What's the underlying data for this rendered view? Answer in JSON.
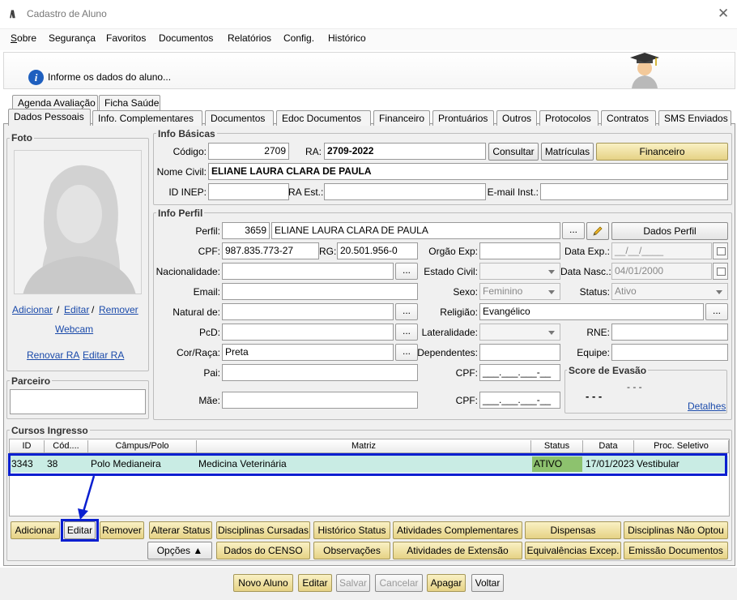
{
  "window": {
    "title": "Cadastro de Aluno",
    "logo": "/\\\\",
    "close_glyph": "✕"
  },
  "menu": [
    "Sobre",
    "Segurança",
    "Favoritos",
    "Documentos",
    "Relatórios",
    "Config.",
    "Histórico"
  ],
  "header": {
    "info_text": "Informe os dados do aluno...",
    "info_icon": "i"
  },
  "tabs_top": [
    "Agenda Avaliação",
    "Ficha Saúde"
  ],
  "tabs": [
    "Dados Pessoais",
    "Info. Complementares",
    "Documentos",
    "Edoc Documentos",
    "Financeiro",
    "Prontuários",
    "Outros",
    "Protocolos",
    "Contratos",
    "SMS Enviados"
  ],
  "foto": {
    "title": "Foto",
    "adicionar": "Adicionar",
    "sep1": "/",
    "editar": "Editar",
    "sep2": "/",
    "remover": "Remover",
    "webcam": "Webcam",
    "renovar_ra": "Renovar RA",
    "editar_ra": "Editar RA"
  },
  "parceiro": {
    "title": "Parceiro"
  },
  "info_basicas": {
    "title": "Info Básicas",
    "codigo_label": "Código:",
    "codigo": "2709",
    "ra_label": "RA:",
    "ra": "2709-2022",
    "consultar": "Consultar",
    "matriculas": "Matrículas",
    "financeiro": "Financeiro",
    "nome_civil_label": "Nome Civil:",
    "nome_civil": "ELIANE LAURA CLARA DE PAULA",
    "id_inep_label": "ID INEP:",
    "ra_est_label": "RA Est.:",
    "email_inst_label": "E-mail Inst.:"
  },
  "info_perfil": {
    "title": "Info Perfil",
    "perfil_label": "Perfil:",
    "perfil_id": "3659",
    "perfil_nome": "ELIANE LAURA CLARA DE PAULA",
    "dots": "...",
    "dados_perfil": "Dados Perfil",
    "cpf_label": "CPF:",
    "cpf": "987.835.773-27",
    "rg_label": "RG:",
    "rg": "20.501.956-0",
    "orgao_label": "Orgão Exp:",
    "data_exp_label": "Data Exp.:",
    "data_exp": "__/__/____",
    "nacionalidade_label": "Nacionalidade:",
    "estado_civil_label": "Estado Civil:",
    "data_nasc_label": "Data Nasc.:",
    "data_nasc": "04/01/2000",
    "email_label": "Email:",
    "sexo_label": "Sexo:",
    "sexo": "Feminino",
    "status_label": "Status:",
    "status": "Ativo",
    "natural_label": "Natural de:",
    "religiao_label": "Religião:",
    "religiao": "Evangélico",
    "pcd_label": "PcD:",
    "lateralidade_label": "Lateralidade:",
    "rne_label": "RNE:",
    "cor_label": "Cor/Raça:",
    "cor": "Preta",
    "dependentes_label": "Dependentes:",
    "equipe_label": "Equipe:",
    "pai_label": "Pai:",
    "cpf_pai_label": "CPF:",
    "cpf_pai": "___.___.___-__",
    "mae_label": "Mãe:",
    "cpf_mae_label": "CPF:",
    "cpf_mae": "___.___.___-__",
    "score_title": "Score de Evasão",
    "score_top": "- - -",
    "score_value": "- - -",
    "detalhes": "Detalhes"
  },
  "cursos": {
    "title": "Cursos Ingresso",
    "columns": [
      "ID",
      "Cód....",
      "Câmpus/Polo",
      "Matriz",
      "Status",
      "Data",
      "Proc. Seletivo"
    ],
    "rows": [
      {
        "id": "3343",
        "cod": "38",
        "campus": "Polo Medianeira",
        "matriz": "Medicina Veterinária",
        "status": "ATIVO",
        "data": "17/01/2023",
        "proc": "Vestibular"
      }
    ],
    "buttons_row1": [
      "Adicionar",
      "Editar",
      "Remover",
      "Alterar Status",
      "Disciplinas Cursadas",
      "Histórico Status",
      "Atividades Complementares",
      "Dispensas",
      "Disciplinas Não Optou"
    ],
    "buttons_row2": [
      "Opções ▲",
      "Dados do CENSO",
      "Observações",
      "Atividades de Extensão",
      "Equivalências Excep.",
      "Emissão Documentos"
    ]
  },
  "footer": [
    "Novo Aluno",
    "Editar",
    "Salvar",
    "Cancelar",
    "Apagar",
    "Voltar"
  ],
  "colors": {
    "highlight": "#0a1fd0",
    "row_selected": "#c9ece4",
    "status_active": "#8dc26e",
    "gold": "#e6d285"
  }
}
